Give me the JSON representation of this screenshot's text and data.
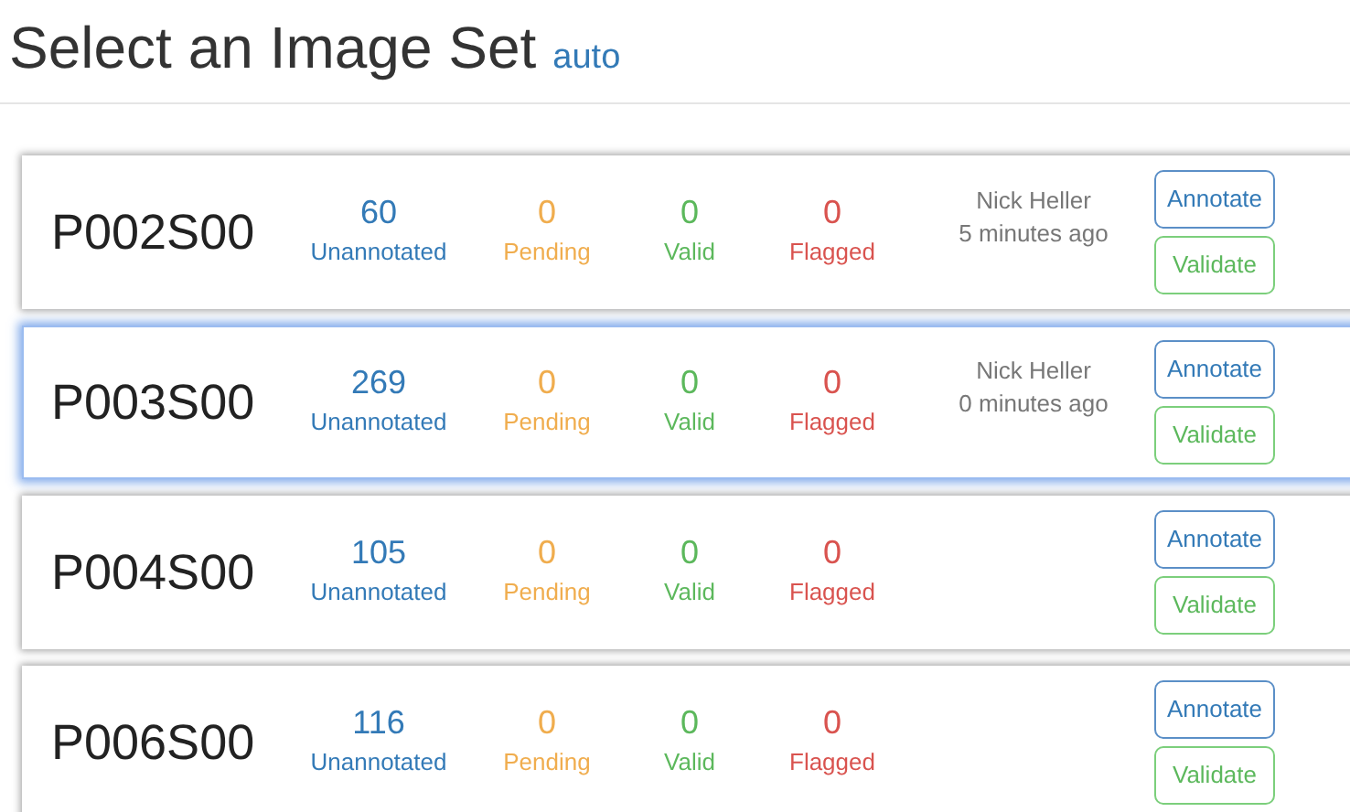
{
  "header": {
    "title": "Select an Image Set",
    "subtitle": "auto"
  },
  "image_sets": [
    {
      "name": "P002S00",
      "selected": false,
      "stats": [
        {
          "kind": "unannotated",
          "value": "60",
          "label": "Unannotated"
        },
        {
          "kind": "pending",
          "value": "0",
          "label": "Pending"
        },
        {
          "kind": "valid",
          "value": "0",
          "label": "Valid"
        },
        {
          "kind": "flagged",
          "value": "0",
          "label": "Flagged"
        }
      ],
      "user": "Nick Heller",
      "time": "5 minutes ago",
      "buttons": [
        {
          "kind": "annotate",
          "label": "Annotate"
        },
        {
          "kind": "validate",
          "label": "Validate"
        }
      ]
    },
    {
      "name": "P003S00",
      "selected": true,
      "stats": [
        {
          "kind": "unannotated",
          "value": "269",
          "label": "Unannotated"
        },
        {
          "kind": "pending",
          "value": "0",
          "label": "Pending"
        },
        {
          "kind": "valid",
          "value": "0",
          "label": "Valid"
        },
        {
          "kind": "flagged",
          "value": "0",
          "label": "Flagged"
        }
      ],
      "user": "Nick Heller",
      "time": "0 minutes ago",
      "buttons": [
        {
          "kind": "annotate",
          "label": "Annotate"
        },
        {
          "kind": "validate",
          "label": "Validate"
        }
      ]
    },
    {
      "name": "P004S00",
      "selected": false,
      "stats": [
        {
          "kind": "unannotated",
          "value": "105",
          "label": "Unannotated"
        },
        {
          "kind": "pending",
          "value": "0",
          "label": "Pending"
        },
        {
          "kind": "valid",
          "value": "0",
          "label": "Valid"
        },
        {
          "kind": "flagged",
          "value": "0",
          "label": "Flagged"
        }
      ],
      "buttons": [
        {
          "kind": "annotate",
          "label": "Annotate"
        },
        {
          "kind": "validate",
          "label": "Validate"
        }
      ]
    },
    {
      "name": "P006S00",
      "selected": false,
      "stats": [
        {
          "kind": "unannotated",
          "value": "116",
          "label": "Unannotated"
        },
        {
          "kind": "pending",
          "value": "0",
          "label": "Pending"
        },
        {
          "kind": "valid",
          "value": "0",
          "label": "Valid"
        },
        {
          "kind": "flagged",
          "value": "0",
          "label": "Flagged"
        }
      ],
      "buttons": [
        {
          "kind": "annotate",
          "label": "Annotate"
        },
        {
          "kind": "validate",
          "label": "Validate"
        }
      ]
    }
  ]
}
